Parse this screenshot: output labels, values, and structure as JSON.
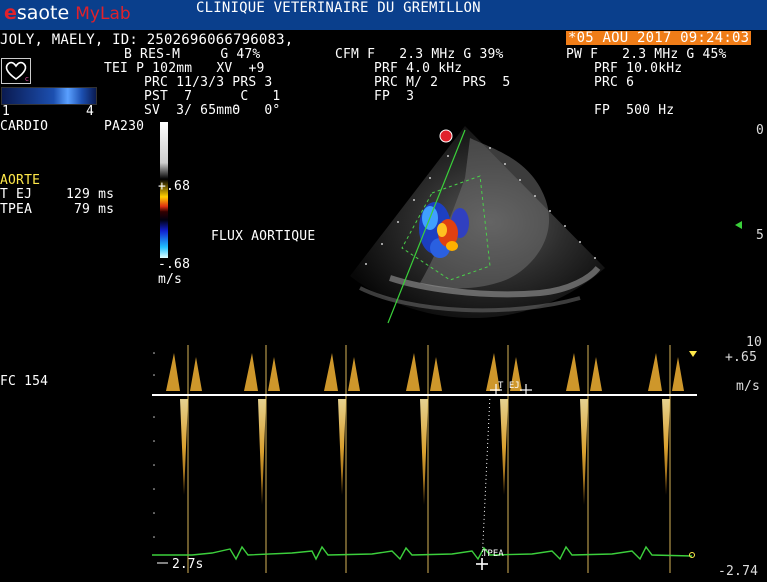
{
  "header": {
    "brand": "esaote",
    "brand_e": "e",
    "brand_rest": "saote",
    "product": "MyLab",
    "clinic": "CLINIQUE VETERINAIRE DU GREMILLON"
  },
  "patient": {
    "line": "JOLY, MAELY, ID: 2502696066796083,",
    "datetime": "*05 AOU 2017 09:24:03"
  },
  "params": {
    "b_row1": "B RES-M     G 47%",
    "b_row2": "TEI P 102mm   XV  +9",
    "b_row3": "PRC 11/3/3 PRS 3",
    "b_row4": "PST  7      C   1",
    "b_row5": "SV  3/ 65mmΘ   0°",
    "cfm_row1": "CFM F   2.3 MHz G 39%",
    "cfm_row2": "PRF 4.0 kHz",
    "cfm_row3": "PRC M/ 2   PRS  5",
    "cfm_row4": "FP  3",
    "pw_row1": "PW F   2.3 MHz G 45%",
    "pw_row2": "PRF 10.0kHz",
    "pw_row3": "PRC 6",
    "pw_row4": "FP  500 Hz"
  },
  "left": {
    "probe_scale_left": "1",
    "probe_scale_right": "4",
    "mode": "CARDIO",
    "probe": "PA230",
    "section": "AORTE",
    "measure1_label": "T EJ",
    "measure1_value": "129 ms",
    "measure2_label": "TPEA",
    "measure2_value": " 79 ms",
    "hr": "FC 154"
  },
  "colorscale": {
    "top": "+.68",
    "bottom": "-.68",
    "unit": "m/s"
  },
  "image": {
    "annotation": "FLUX AORTIQUE"
  },
  "right": {
    "depth0": "0",
    "depth5": "5",
    "depth10": "10",
    "vel_top": "+.65",
    "vel_unit": "m/s",
    "vel_bottom": "-2.74"
  },
  "doppler": {
    "sweep": "2.7s",
    "marker_tej": "T EJ",
    "marker_tpea": "TPEA"
  },
  "colors": {
    "header_bg": "#0a3f8c",
    "date_bg": "#f07d18",
    "label_yellow": "#ffe94a",
    "ecg_green": "#3ccf3c",
    "doppler_gold": "#f2b233"
  }
}
